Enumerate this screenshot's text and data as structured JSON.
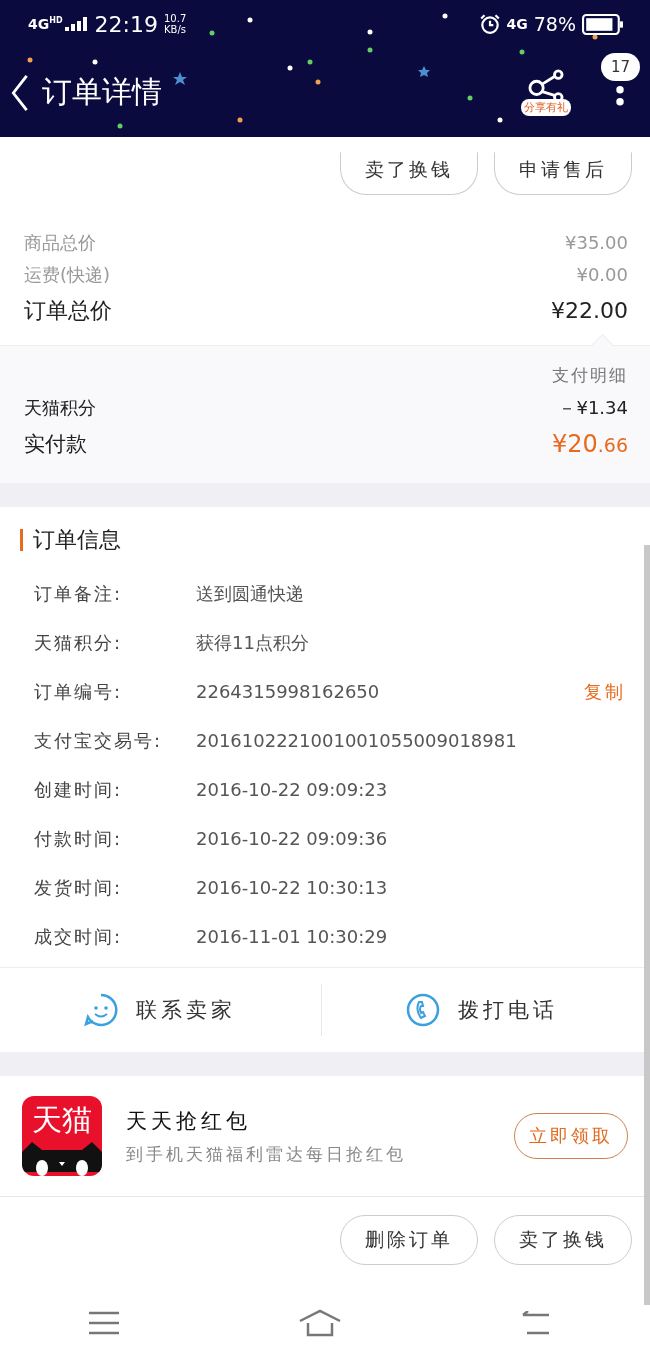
{
  "status_bar": {
    "signal_label": "4G$^{HD}$",
    "time": "22:19",
    "speed": "10.7",
    "speed_unit": "KB/s",
    "network": "4G",
    "battery": "78%"
  },
  "header": {
    "title": "订单详情",
    "share_label": "分享有礼",
    "badge": "17"
  },
  "top_actions": [
    "卖了换钱",
    "申请售后"
  ],
  "price_summary": [
    {
      "label": "商品总价",
      "value": "¥35.00",
      "kind": "minor"
    },
    {
      "label": "运费(快递)",
      "value": "¥0.00",
      "kind": "minor"
    },
    {
      "label": "订单总价",
      "value": "¥22.00",
      "kind": "major"
    }
  ],
  "payment": {
    "detail_link": "支付明细",
    "rows": [
      {
        "label": "天猫积分",
        "value": "－¥1.34",
        "kind": "plain"
      },
      {
        "label": "实付款",
        "value": "¥20",
        "fraction": ".66",
        "kind": "total"
      }
    ]
  },
  "order_info": {
    "title": "订单信息",
    "rows": [
      {
        "label": "订单备注:",
        "value": "送到圆通快递"
      },
      {
        "label": "天猫积分:",
        "value": "获得11点积分"
      },
      {
        "label": "订单编号:",
        "value": "2264315998162650",
        "action": "复制"
      },
      {
        "label": "支付宝交易号:",
        "value": "2016102221001001055009018981"
      },
      {
        "label": "创建时间:",
        "value": "2016-10-22 09:09:23"
      },
      {
        "label": "付款时间:",
        "value": "2016-10-22 09:09:36"
      },
      {
        "label": "发货时间:",
        "value": "2016-10-22 10:30:13"
      },
      {
        "label": "成交时间:",
        "value": "2016-11-01 10:30:29"
      }
    ]
  },
  "contact": [
    {
      "label": "联系卖家",
      "kind": "chat"
    },
    {
      "label": "拨打电话",
      "kind": "phone"
    }
  ],
  "promo": {
    "app_label": "天猫",
    "title": "天天抢红包",
    "subtitle": "到手机天猫福利雷达每日抢红包",
    "button": "立即领取"
  },
  "bottom_actions": [
    "删除订单",
    "卖了换钱"
  ]
}
